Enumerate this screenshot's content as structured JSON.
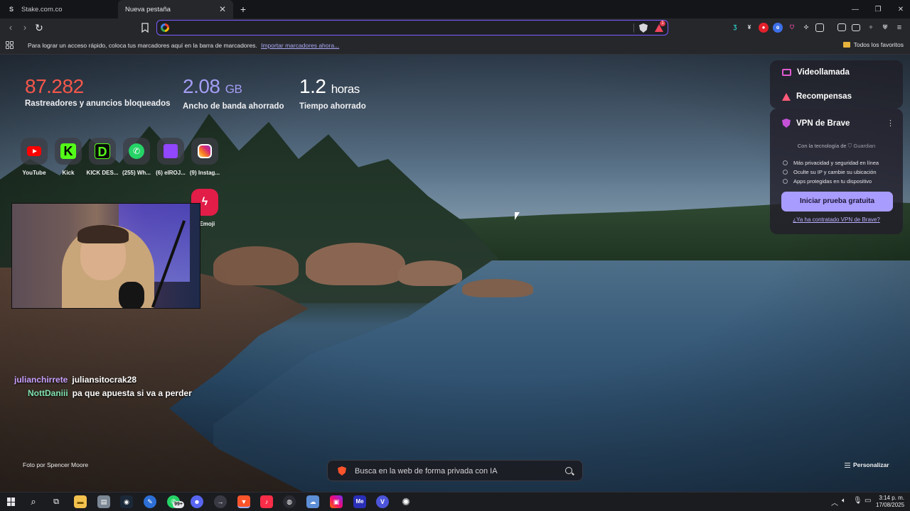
{
  "tabs": [
    {
      "title": "Stake.com.co",
      "favicon": "S",
      "active": false
    },
    {
      "title": "Nueva pestaña",
      "active": true
    }
  ],
  "toolbar": {
    "address_value": "",
    "rewards_badge": "1"
  },
  "bookmarks_bar": {
    "hint": "Para lograr un acceso rápido, coloca tus marcadores aquí en la barra de marcadores.",
    "import_link": "Importar marcadores ahora...",
    "all_favorites": "Todos los favoritos"
  },
  "stats": [
    {
      "value": "87.282",
      "unit": "",
      "label": "Rastreadores y anuncios bloqueados",
      "color": "#f5574b"
    },
    {
      "value": "2.08",
      "unit": "GB",
      "label": "Ancho de banda ahorrado",
      "color": "#a49df5"
    },
    {
      "value": "1.2",
      "unit": "horas",
      "label": "Tiempo ahorrado",
      "color": "#ffffff"
    }
  ],
  "top_sites": [
    {
      "title": "YouTube",
      "icon": "youtube-icon"
    },
    {
      "title": "Kick",
      "icon": "kick-icon"
    },
    {
      "title": "KICK DES...",
      "icon": "kick-dashboard-icon"
    },
    {
      "title": "(255) Wh...",
      "icon": "whatsapp-icon"
    },
    {
      "title": "(6) elROJ...",
      "icon": "twitch-icon"
    },
    {
      "title": "(9) Instag...",
      "icon": "instagram-icon"
    }
  ],
  "top_sites_row2_visible_title": "a Emoji",
  "chat": [
    {
      "user": "julianchirrete",
      "message": "juliansitocrak28"
    },
    {
      "user": "NottDaniii",
      "message": "pa que apuesta si va a perder"
    }
  ],
  "widgets": {
    "videocall": "Videollamada",
    "rewards": "Recompensas",
    "vpn": {
      "title": "VPN de Brave",
      "powered_by": "Con la tecnología de",
      "partner": "Guardian",
      "features": [
        "Más privacidad y seguridad en línea",
        "Oculte su IP y cambie su ubicación",
        "Apps protegidas en tu dispositivo"
      ],
      "cta": "Iniciar prueba gratuita",
      "already_link": "¿Ya ha contratado VPN de Brave?"
    }
  },
  "photo_credit": "Foto por Spencer Moore",
  "search": {
    "placeholder": "Busca en la web de forma privada con IA"
  },
  "customize_label": "Personalizar",
  "taskbar": {
    "whatsapp_badge": "99+",
    "time": "3:14 p. m.",
    "date": "17/08/2025"
  }
}
